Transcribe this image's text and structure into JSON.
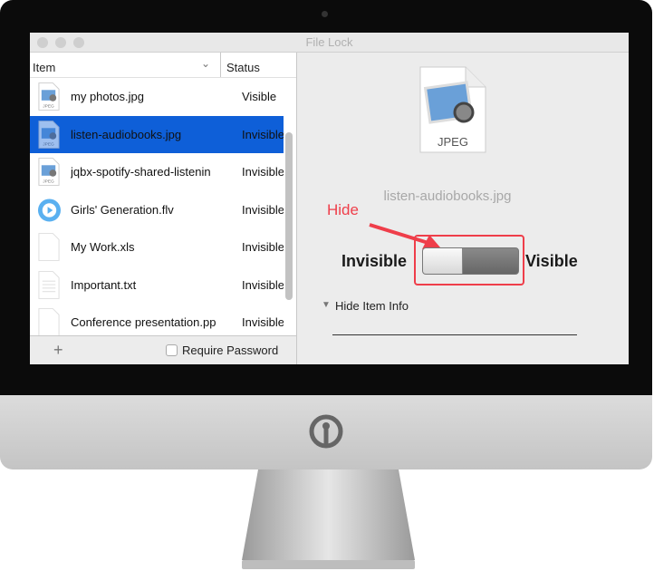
{
  "window": {
    "title": "File Lock"
  },
  "table": {
    "headers": {
      "item": "Item",
      "status": "Status"
    },
    "rows": [
      {
        "name": "my photos.jpg",
        "status": "Visible",
        "icon": "jpeg-file-icon",
        "selected": false
      },
      {
        "name": "listen-audiobooks.jpg",
        "status": "Invisible",
        "icon": "jpeg-file-icon",
        "selected": true
      },
      {
        "name": "jqbx-spotify-shared-listenin",
        "status": "Invisible",
        "icon": "jpeg-file-icon",
        "selected": false
      },
      {
        "name": "Girls' Generation.flv",
        "status": "Invisible",
        "icon": "video-player-icon",
        "selected": false
      },
      {
        "name": "My Work.xls",
        "status": "Invisible",
        "icon": "blank-file-icon",
        "selected": false
      },
      {
        "name": "Important.txt",
        "status": "Invisible",
        "icon": "text-file-icon",
        "selected": false
      },
      {
        "name": "Conference presentation.pp",
        "status": "Invisible",
        "icon": "blank-file-icon",
        "selected": false
      }
    ]
  },
  "bottom": {
    "add": "+",
    "require_password": "Require Password",
    "require_password_checked": false
  },
  "detail": {
    "file_type": "JPEG",
    "file_name": "listen-audiobooks.jpg",
    "invisible_label": "Invisible",
    "visible_label": "Visible",
    "switch_state": "Invisible",
    "hide_item_info": "Hide Item Info",
    "annotation": "Hide",
    "annotation_color": "#ef3e4a"
  },
  "colors": {
    "selection": "#0e5fd8"
  }
}
